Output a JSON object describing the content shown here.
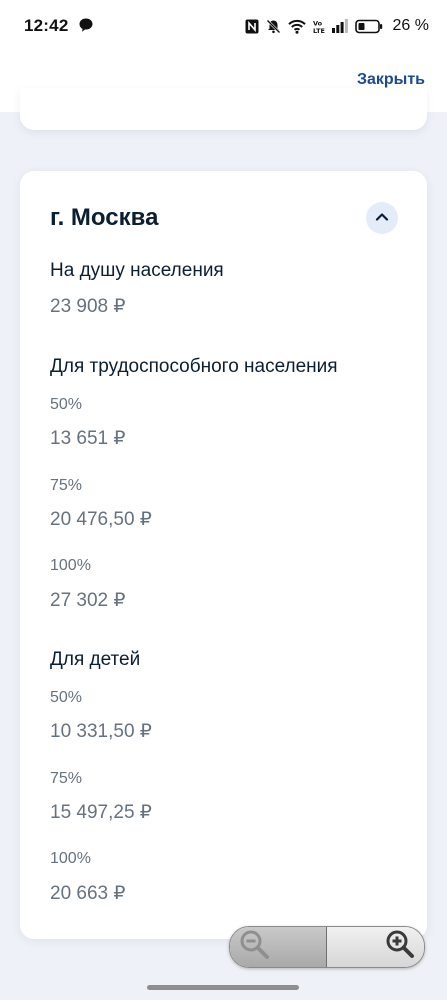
{
  "status_bar": {
    "time": "12:42",
    "battery_percent": "26 %",
    "icons": [
      "chat-icon",
      "nfc-icon",
      "mute-icon",
      "wifi-icon",
      "volte-icon",
      "signal-icon",
      "battery-icon"
    ]
  },
  "header": {
    "close_label": "Закрыть"
  },
  "region": {
    "title": "г. Москва",
    "per_capita": {
      "label": "На душу населения",
      "value": "23 908 ₽"
    },
    "working_age": {
      "label": "Для трудоспособного населения",
      "rows": [
        {
          "percent": "50%",
          "value": "13 651 ₽"
        },
        {
          "percent": "75%",
          "value": "20 476,50 ₽"
        },
        {
          "percent": "100%",
          "value": "27 302 ₽"
        }
      ]
    },
    "children": {
      "label": "Для детей",
      "rows": [
        {
          "percent": "50%",
          "value": "10 331,50 ₽"
        },
        {
          "percent": "75%",
          "value": "15 497,25 ₽"
        },
        {
          "percent": "100%",
          "value": "20 663 ₽"
        }
      ]
    }
  },
  "colors": {
    "background": "#eef1f7",
    "card": "#ffffff",
    "link": "#1b4b8f",
    "text_primary": "#0b1f33",
    "text_secondary": "#66727f",
    "chevron_bg": "#e4ecfa"
  }
}
